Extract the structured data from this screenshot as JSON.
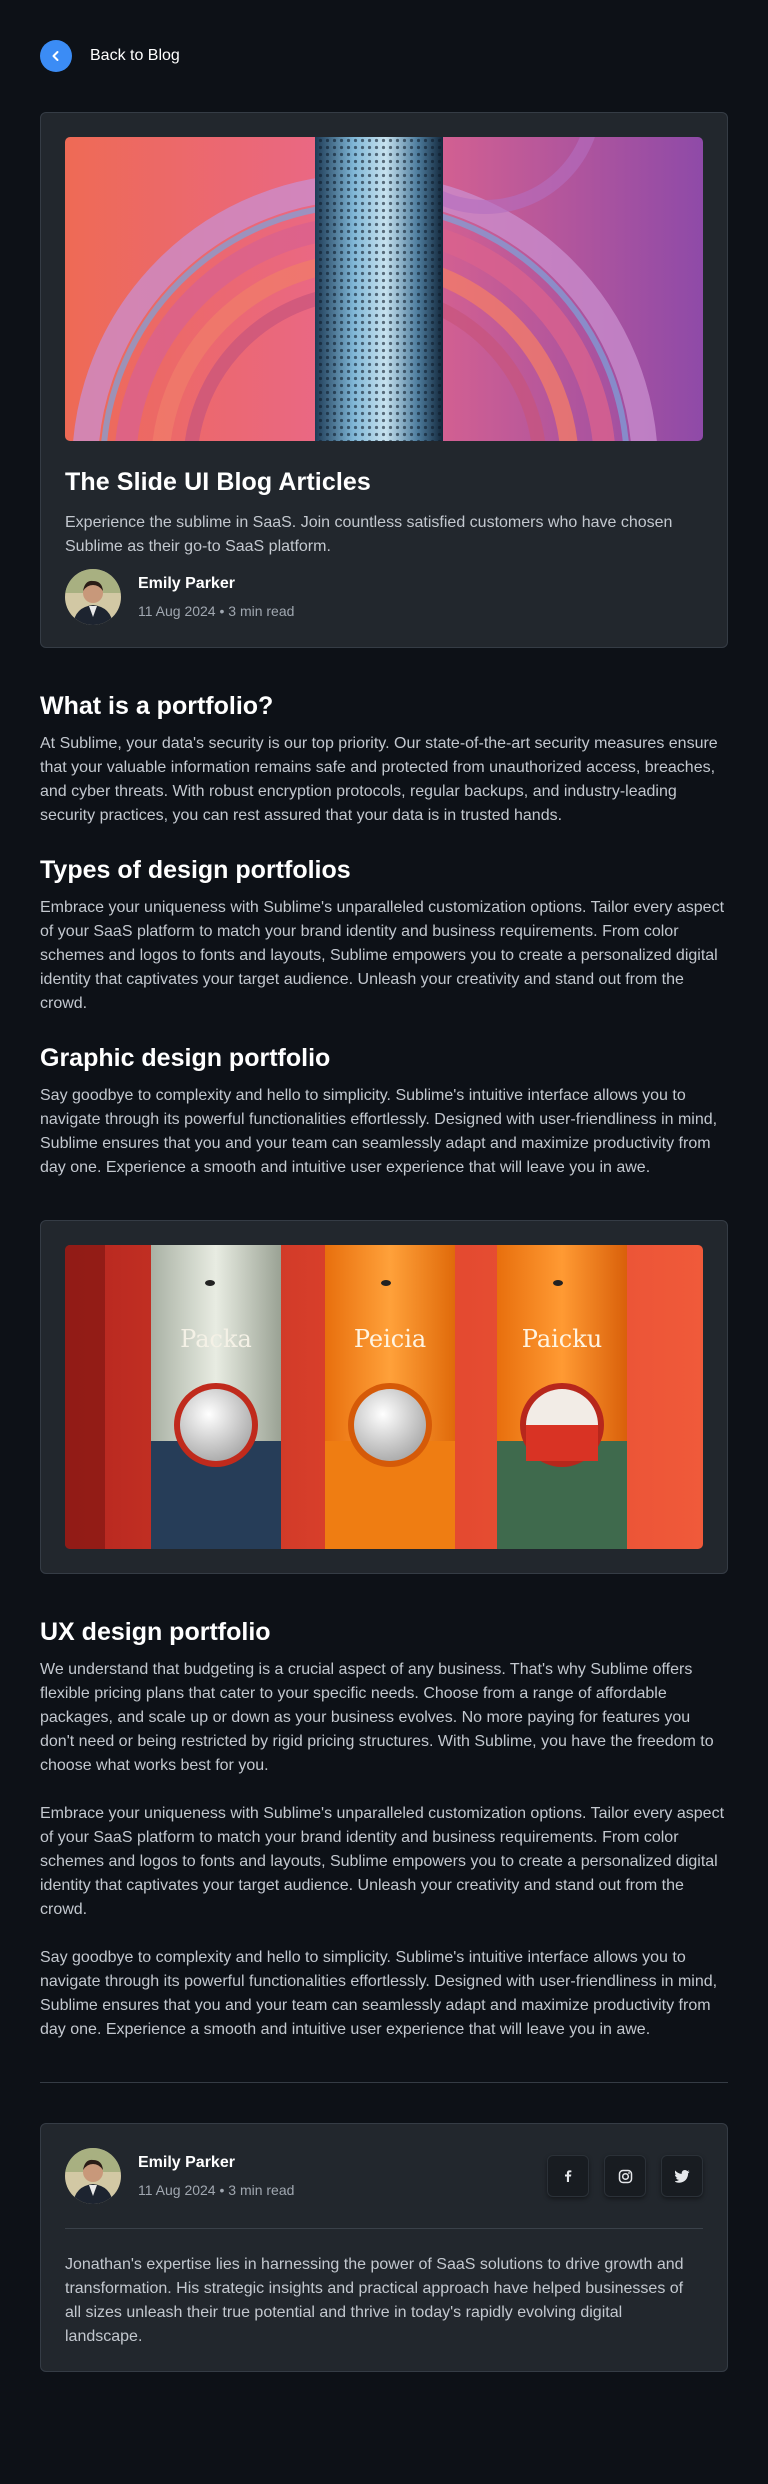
{
  "nav": {
    "back_label": "Back to Blog"
  },
  "hero": {
    "title": "The Slide UI Blog Articles",
    "description": "Experience the sublime in SaaS. Join countless satisfied customers who have chosen Sublime as their go-to SaaS platform."
  },
  "author": {
    "name": "Emily Parker",
    "meta": "11 Aug 2024 • 3 min read"
  },
  "sections": [
    {
      "heading": "What is a portfolio?",
      "body": "At Sublime, your data's security is our top priority. Our state-of-the-art security measures ensure that your valuable information remains safe and protected from unauthorized access, breaches, and cyber threats. With robust encryption protocols, regular backups, and industry-leading security practices, you can rest assured that your data is in trusted hands."
    },
    {
      "heading": "Types of design portfolios",
      "body": "Embrace your uniqueness with Sublime's unparalleled customization options. Tailor every aspect of your SaaS platform to match your brand identity and business requirements. From color schemes and logos to fonts and layouts, Sublime empowers you to create a personalized digital identity that captivates your target audience. Unleash your creativity and stand out from the crowd."
    },
    {
      "heading": "Graphic design portfolio",
      "body": "Say goodbye to complexity and hello to simplicity. Sublime's intuitive interface allows you to navigate through its powerful functionalities effortlessly. Designed with user-friendliness in mind, Sublime ensures that you and your team can seamlessly adapt and maximize productivity from day one. Experience a smooth and intuitive user experience that will leave you in awe."
    }
  ],
  "product_image": {
    "labels": [
      "Packa",
      "Peicia",
      "Paicku"
    ]
  },
  "ux": {
    "heading": "UX design portfolio",
    "paragraphs": [
      "We understand that budgeting is a crucial aspect of any business. That's why Sublime offers flexible pricing plans that cater to your specific needs. Choose from a range of affordable packages, and scale up or down as your business evolves. No more paying for features you don't need or being restricted by rigid pricing structures. With Sublime, you have the freedom to choose what works best for you.",
      "Embrace your uniqueness with Sublime's unparalleled customization options. Tailor every aspect of your SaaS platform to match your brand identity and business requirements. From color schemes and logos to fonts and layouts, Sublime empowers you to create a personalized digital identity that captivates your target audience. Unleash your creativity and stand out from the crowd.",
      "Say goodbye to complexity and hello to simplicity. Sublime's intuitive interface allows you to navigate through its powerful functionalities effortlessly. Designed with user-friendliness in mind, Sublime ensures that you and your team can seamlessly adapt and maximize productivity from day one. Experience a smooth and intuitive user experience that will leave you in awe."
    ]
  },
  "footer": {
    "bio": "Jonathan's expertise lies in harnessing the power of SaaS solutions to drive growth and transformation. His strategic insights and practical approach have helped businesses of all sizes unleash their true potential and thrive in today's rapidly evolving digital landscape.",
    "socials": [
      {
        "icon": "facebook-icon",
        "glyph": "f"
      },
      {
        "icon": "instagram-icon",
        "glyph": "◎"
      },
      {
        "icon": "twitter-icon",
        "glyph": "🐦"
      }
    ]
  },
  "colors": {
    "background": "#0d1117",
    "card": "#22272d",
    "accent": "#3b8cf5"
  }
}
